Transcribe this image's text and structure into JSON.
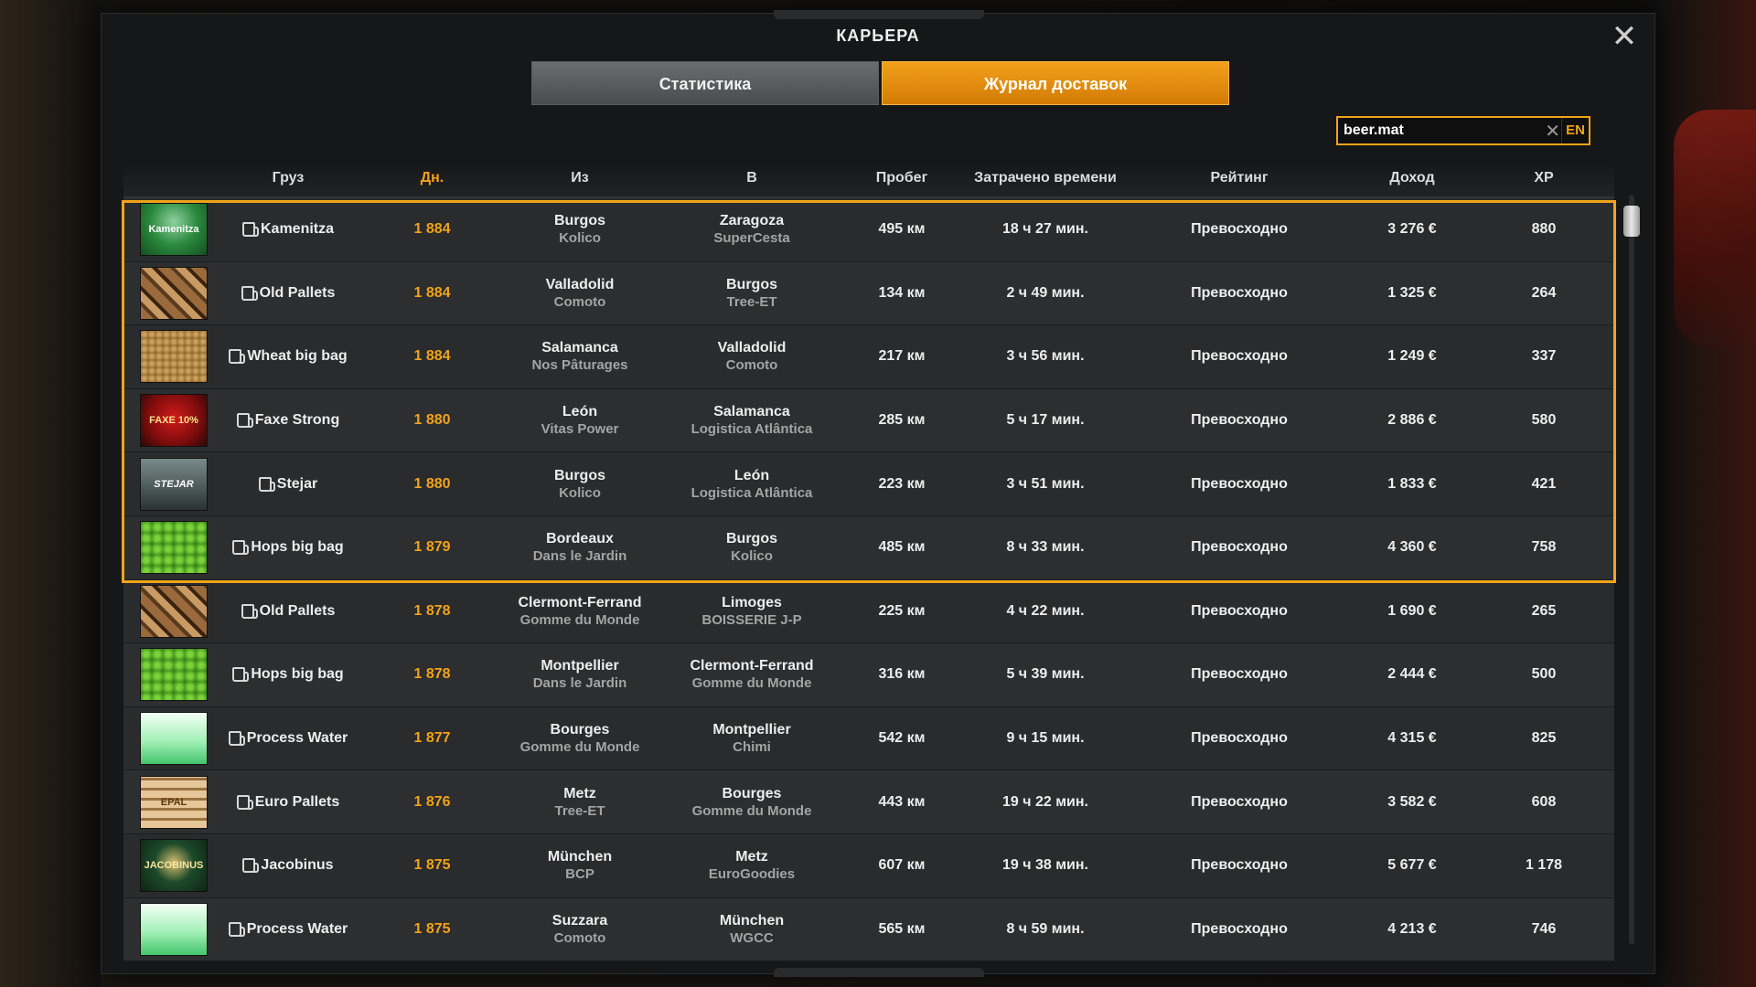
{
  "window": {
    "title": "КАРЬЕРА",
    "close_glyph": "✕"
  },
  "tabs": [
    {
      "label": "Статистика",
      "active": false
    },
    {
      "label": "Журнал доставок",
      "active": true
    }
  ],
  "search": {
    "value": "beer.mat",
    "clear_glyph": "✕",
    "lang": "EN"
  },
  "columns": {
    "cargo": "Груз",
    "day": "Дн.",
    "from": "Из",
    "to": "В",
    "distance": "Пробег",
    "time": "Затрачено времени",
    "rating": "Рейтинг",
    "income": "Доход",
    "xp": "XP"
  },
  "rows": [
    {
      "icon": "kamenitza",
      "icon_text": "Kamenitza",
      "cargo": "Kamenitza",
      "day": "1 884",
      "from_city": "Burgos",
      "from_company": "Kolico",
      "to_city": "Zaragoza",
      "to_company": "SuperCesta",
      "distance": "495 км",
      "time": "18 ч 27 мин.",
      "rating": "Превосходно",
      "income": "3 276 €",
      "xp": "880"
    },
    {
      "icon": "pallets",
      "icon_text": "",
      "cargo": "Old Pallets",
      "day": "1 884",
      "from_city": "Valladolid",
      "from_company": "Comoto",
      "to_city": "Burgos",
      "to_company": "Tree-ET",
      "distance": "134 км",
      "time": "2 ч 49 мин.",
      "rating": "Превосходно",
      "income": "1 325 €",
      "xp": "264"
    },
    {
      "icon": "wheat",
      "icon_text": "",
      "cargo": "Wheat big bag",
      "day": "1 884",
      "from_city": "Salamanca",
      "from_company": "Nos Pâturages",
      "to_city": "Valladolid",
      "to_company": "Comoto",
      "distance": "217 км",
      "time": "3 ч 56 мин.",
      "rating": "Превосходно",
      "income": "1 249 €",
      "xp": "337"
    },
    {
      "icon": "faxe",
      "icon_text": "FAXE 10%",
      "cargo": "Faxe Strong",
      "day": "1 880",
      "from_city": "León",
      "from_company": "Vitas Power",
      "to_city": "Salamanca",
      "to_company": "Logistica Atlântica",
      "distance": "285 км",
      "time": "5 ч 17 мин.",
      "rating": "Превосходно",
      "income": "2 886 €",
      "xp": "580"
    },
    {
      "icon": "stejar",
      "icon_text": "STEJAR",
      "cargo": "Stejar",
      "day": "1 880",
      "from_city": "Burgos",
      "from_company": "Kolico",
      "to_city": "León",
      "to_company": "Logistica Atlântica",
      "distance": "223 км",
      "time": "3 ч 51 мин.",
      "rating": "Превосходно",
      "income": "1 833 €",
      "xp": "421"
    },
    {
      "icon": "hops",
      "icon_text": "",
      "cargo": "Hops big bag",
      "day": "1 879",
      "from_city": "Bordeaux",
      "from_company": "Dans le Jardin",
      "to_city": "Burgos",
      "to_company": "Kolico",
      "distance": "485 км",
      "time": "8 ч 33 мин.",
      "rating": "Превосходно",
      "income": "4 360 €",
      "xp": "758"
    },
    {
      "icon": "pallets",
      "icon_text": "",
      "cargo": "Old Pallets",
      "day": "1 878",
      "from_city": "Clermont-Ferrand",
      "from_company": "Gomme du Monde",
      "to_city": "Limoges",
      "to_company": "BOISSERIE J-P",
      "distance": "225 км",
      "time": "4 ч 22 мин.",
      "rating": "Превосходно",
      "income": "1 690 €",
      "xp": "265"
    },
    {
      "icon": "hops",
      "icon_text": "",
      "cargo": "Hops big bag",
      "day": "1 878",
      "from_city": "Montpellier",
      "from_company": "Dans le Jardin",
      "to_city": "Clermont-Ferrand",
      "to_company": "Gomme du Monde",
      "distance": "316 км",
      "time": "5 ч 39 мин.",
      "rating": "Превосходно",
      "income": "2 444 €",
      "xp": "500"
    },
    {
      "icon": "water",
      "icon_text": "",
      "cargo": "Process Water",
      "day": "1 877",
      "from_city": "Bourges",
      "from_company": "Gomme du Monde",
      "to_city": "Montpellier",
      "to_company": "Chimi",
      "distance": "542 км",
      "time": "9 ч 15 мин.",
      "rating": "Превосходно",
      "income": "4 315 €",
      "xp": "825"
    },
    {
      "icon": "euro",
      "icon_text": "EPAL",
      "cargo": "Euro Pallets",
      "day": "1 876",
      "from_city": "Metz",
      "from_company": "Tree-ET",
      "to_city": "Bourges",
      "to_company": "Gomme du Monde",
      "distance": "443 км",
      "time": "19 ч 22 мин.",
      "rating": "Превосходно",
      "income": "3 582 €",
      "xp": "608"
    },
    {
      "icon": "jacob",
      "icon_text": "JACOBINUS",
      "cargo": "Jacobinus",
      "day": "1 875",
      "from_city": "München",
      "from_company": "BCP",
      "to_city": "Metz",
      "to_company": "EuroGoodies",
      "distance": "607 км",
      "time": "19 ч 38 мин.",
      "rating": "Превосходно",
      "income": "5 677 €",
      "xp": "1 178"
    },
    {
      "icon": "water",
      "icon_text": "",
      "cargo": "Process Water",
      "day": "1 875",
      "from_city": "Suzzara",
      "from_company": "Comoto",
      "to_city": "München",
      "to_company": "WGCC",
      "distance": "565 км",
      "time": "8 ч 59 мин.",
      "rating": "Превосходно",
      "income": "4 213 €",
      "xp": "746"
    }
  ],
  "colors": {
    "accent": "#f0a31a",
    "panel": "#161718",
    "row": "#2a2b2c",
    "subtext": "#a4a4a4"
  }
}
